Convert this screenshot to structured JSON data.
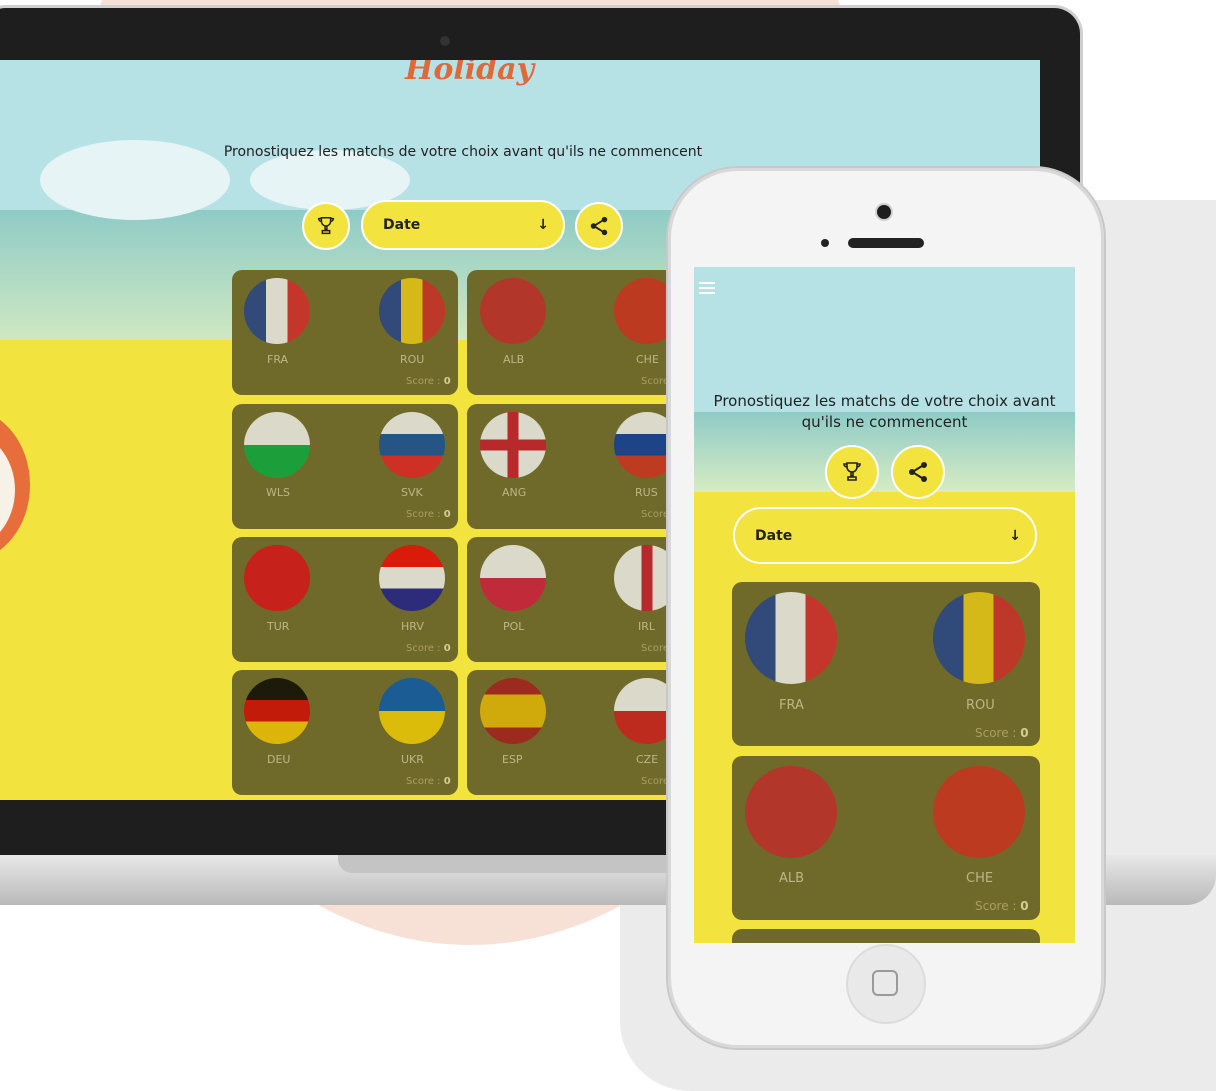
{
  "app": {
    "logo_text": "Holiday"
  },
  "desktop": {
    "tagline": "Pronostiquez les matchs de votre choix avant qu'ils ne commencent",
    "sort_label": "Date",
    "sort_arrow": "↓",
    "matches": [
      {
        "home": "FRA",
        "away": "ROU",
        "score_label": "Score :",
        "score": "0"
      },
      {
        "home": "ALB",
        "away": "CHE",
        "score_label": "Score",
        "score": ""
      },
      {
        "home": "WLS",
        "away": "SVK",
        "score_label": "Score :",
        "score": "0"
      },
      {
        "home": "ANG",
        "away": "RUS",
        "score_label": "Score",
        "score": ""
      },
      {
        "home": "TUR",
        "away": "HRV",
        "score_label": "Score :",
        "score": "0"
      },
      {
        "home": "POL",
        "away": "IRL",
        "score_label": "Score",
        "score": ""
      },
      {
        "home": "DEU",
        "away": "UKR",
        "score_label": "Score :",
        "score": "0"
      },
      {
        "home": "ESP",
        "away": "CZE",
        "score_label": "Score",
        "score": ""
      }
    ]
  },
  "mobile": {
    "tagline": "Pronostiquez les matchs de votre choix avant qu'ils ne commencent",
    "sort_label": "Date",
    "sort_arrow": "↓",
    "matches": [
      {
        "home": "FRA",
        "away": "ROU",
        "score_label": "Score :",
        "score": "0"
      },
      {
        "home": "ALB",
        "away": "CHE",
        "score_label": "Score :",
        "score": "0"
      }
    ]
  },
  "colors": {
    "accent_yellow": "#f3e33e",
    "card": "#6f6a2a",
    "logo": "#e0693b"
  }
}
